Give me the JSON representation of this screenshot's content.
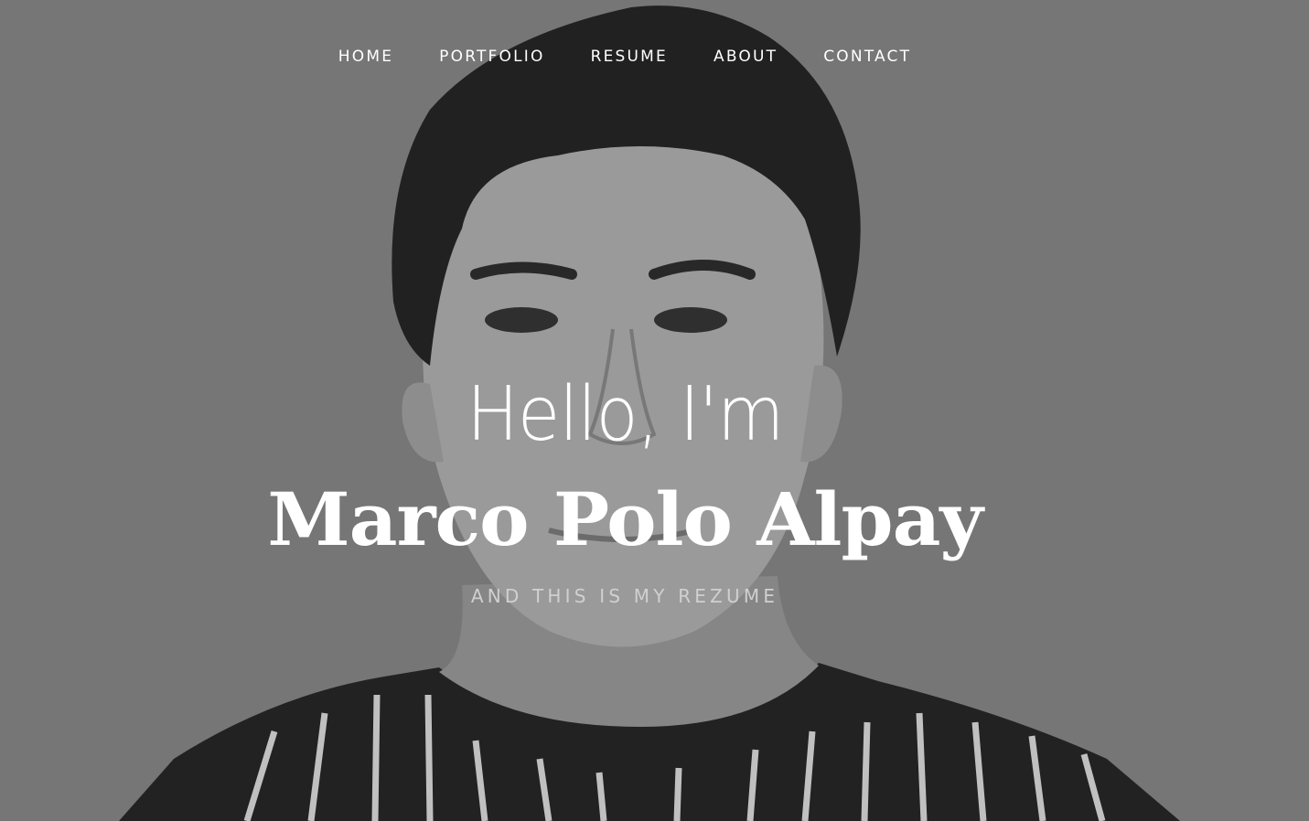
{
  "nav": {
    "items": [
      {
        "label": "HOME"
      },
      {
        "label": "PORTFOLIO"
      },
      {
        "label": "RESUME"
      },
      {
        "label": "ABOUT"
      },
      {
        "label": "CONTACT"
      }
    ]
  },
  "banner": {
    "greeting": "Hello, I'm",
    "name": "Marco Polo Alpay",
    "tagline": "AND THIS IS MY REZUME"
  },
  "colors": {
    "background": "#7a7a7a",
    "text": "#ffffff",
    "tagline": "#d0d0d0"
  }
}
